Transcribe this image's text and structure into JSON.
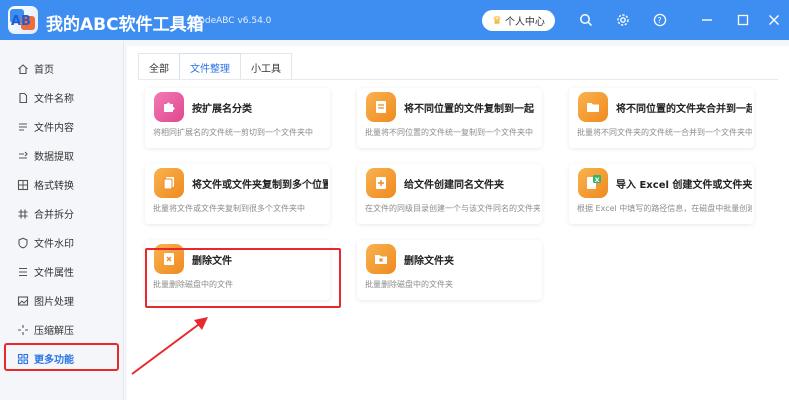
{
  "app": {
    "title": "我的ABC软件工具箱",
    "version": "WodeABC v6.54.0",
    "logo_text": "AB",
    "user_center": "个人中心"
  },
  "titlebar_icons": [
    "search-icon",
    "gear-icon",
    "help-icon",
    "minimize-icon",
    "close-icon"
  ],
  "sidebar": {
    "items": [
      {
        "label": "首页",
        "icon": "home-icon"
      },
      {
        "label": "文件名称",
        "icon": "file-name-icon"
      },
      {
        "label": "文件内容",
        "icon": "file-content-icon"
      },
      {
        "label": "数据提取",
        "icon": "data-extract-icon"
      },
      {
        "label": "格式转换",
        "icon": "format-convert-icon"
      },
      {
        "label": "合并拆分",
        "icon": "merge-split-icon"
      },
      {
        "label": "文件水印",
        "icon": "watermark-icon"
      },
      {
        "label": "文件属性",
        "icon": "file-attr-icon"
      },
      {
        "label": "图片处理",
        "icon": "image-icon"
      },
      {
        "label": "压缩解压",
        "icon": "compress-icon"
      },
      {
        "label": "更多功能",
        "icon": "more-grid-icon",
        "active": true
      }
    ]
  },
  "tabs": [
    {
      "label": "全部"
    },
    {
      "label": "文件整理",
      "active": true
    },
    {
      "label": "小工具"
    }
  ],
  "cards": [
    {
      "title": "按扩展名分类",
      "desc": "将相同扩展名的文件统一剪切到一个文件夹中",
      "icon": "puzzle-icon"
    },
    {
      "title": "将不同位置的文件复制到一起",
      "desc": "批量将不同位置的文件统一复制到一个文件夹中",
      "icon": "document-copy-icon"
    },
    {
      "title": "将不同位置的文件夹合并到一起",
      "desc": "批量将不同文件夹的文件统一合并到一个文件夹中",
      "icon": "folder-merge-icon"
    },
    {
      "title": "将文件或文件夹复制到多个位置",
      "desc": "批量将文件或文件夹复制到很多个文件夹中",
      "icon": "multi-copy-icon"
    },
    {
      "title": "给文件创建同名文件夹",
      "desc": "在文件的同级目录创建一个与该文件同名的文件夹。",
      "icon": "folder-create-icon"
    },
    {
      "title": "导入 Excel 创建文件或文件夹",
      "desc": "根据 Excel 中填写的路径信息，在磁盘中批量创建",
      "icon": "excel-icon"
    },
    {
      "title": "删除文件",
      "desc": "批量删除磁盘中的文件",
      "icon": "file-delete-icon"
    },
    {
      "title": "删除文件夹",
      "desc": "批量删除磁盘中的文件夹",
      "icon": "folder-delete-icon"
    }
  ],
  "colors": {
    "titlebar": "#3d8ef0",
    "accent": "#2b74e4",
    "highlight": "#e8282b",
    "icon_orange": "#f59a2c",
    "icon_pink": "#ec5fa0",
    "icon_green": "#32b56a"
  }
}
